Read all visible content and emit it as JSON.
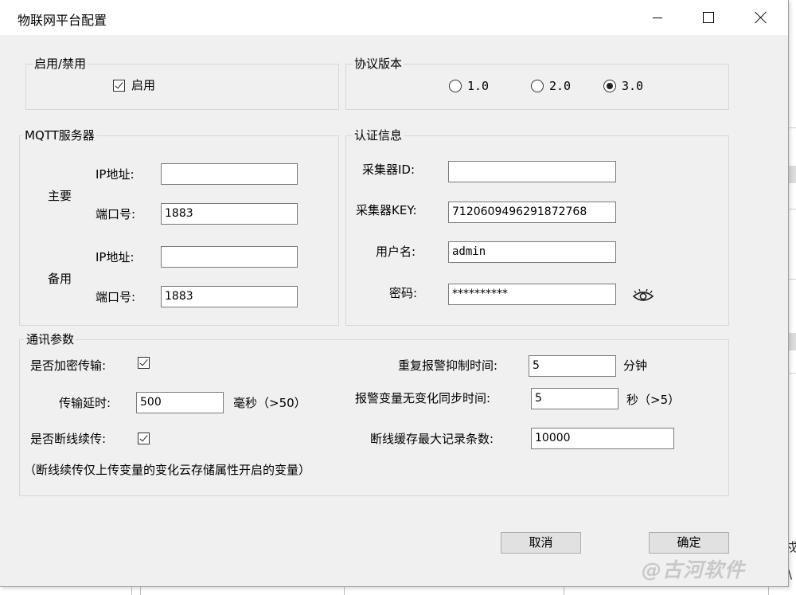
{
  "window": {
    "title": "物联网平台配置"
  },
  "enable_group": {
    "legend": "启用/禁用",
    "checkbox_label": "启用",
    "checked": true
  },
  "protocol_group": {
    "legend": "协议版本",
    "options": [
      {
        "label": "1.0",
        "selected": false
      },
      {
        "label": "2.0",
        "selected": false
      },
      {
        "label": "3.0",
        "selected": true
      }
    ]
  },
  "mqtt_group": {
    "legend": "MQTT服务器",
    "primary": {
      "label": "主要",
      "ip_label": "IP地址:",
      "ip_value": "",
      "port_label": "端口号:",
      "port_value": "1883"
    },
    "backup": {
      "label": "备用",
      "ip_label": "IP地址:",
      "ip_value": "",
      "port_label": "端口号:",
      "port_value": "1883"
    }
  },
  "auth_group": {
    "legend": "认证信息",
    "collector_id_label": "采集器ID:",
    "collector_id_value": "",
    "collector_key_label": "采集器KEY:",
    "collector_key_value": "7120609496291872768",
    "username_label": "用户名:",
    "username_value": "admin",
    "password_label": "密码:",
    "password_value": "**********",
    "show_password_icon": "eye-icon"
  },
  "comm_group": {
    "legend": "通讯参数",
    "encrypt_label": "是否加密传输:",
    "encrypt_checked": true,
    "delay_label": "传输延时:",
    "delay_value": "500",
    "delay_unit": "毫秒（>50）",
    "resume_label": "是否断线续传:",
    "resume_checked": true,
    "note": "（断线续传仅上传变量的变化云存储属性开启的变量）",
    "alarm_suppress_label": "重复报警抑制时间:",
    "alarm_suppress_value": "5",
    "alarm_suppress_unit": "分钟",
    "alarm_sync_label": "报警变量无变化同步时间:",
    "alarm_sync_value": "5",
    "alarm_sync_unit": "秒（>5）",
    "cache_max_label": "断线缓存最大记录条数:",
    "cache_max_value": "10000"
  },
  "buttons": {
    "cancel": "取消",
    "ok": "确定"
  },
  "watermark": "@古河软件",
  "background": {
    "fragment_1": "戍",
    "fragment_2": "\\"
  }
}
